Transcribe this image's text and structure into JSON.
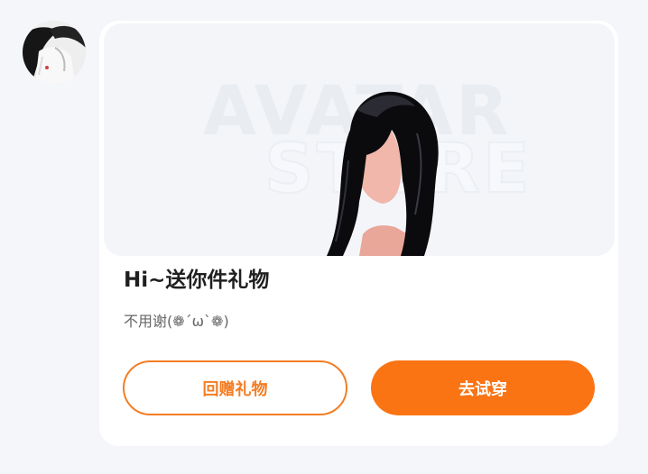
{
  "sender": {
    "avatar_icon": "user-avatar-photo"
  },
  "gift_card": {
    "banner": {
      "watermark_line1": "AVATAR",
      "watermark_line2": "STORE",
      "image_icon": "hairstyle-item-image"
    },
    "title": "Hi~送你件礼物",
    "subtitle": "不用谢(❁´ω`❁)",
    "actions": {
      "return_gift_label": "回赠礼物",
      "try_on_label": "去试穿"
    }
  },
  "colors": {
    "accent": "#fa7414",
    "outline_accent": "#f37d24",
    "card_bg": "#ffffff",
    "page_bg": "#f4f6f9",
    "banner_bg": "#f3f5f9"
  }
}
